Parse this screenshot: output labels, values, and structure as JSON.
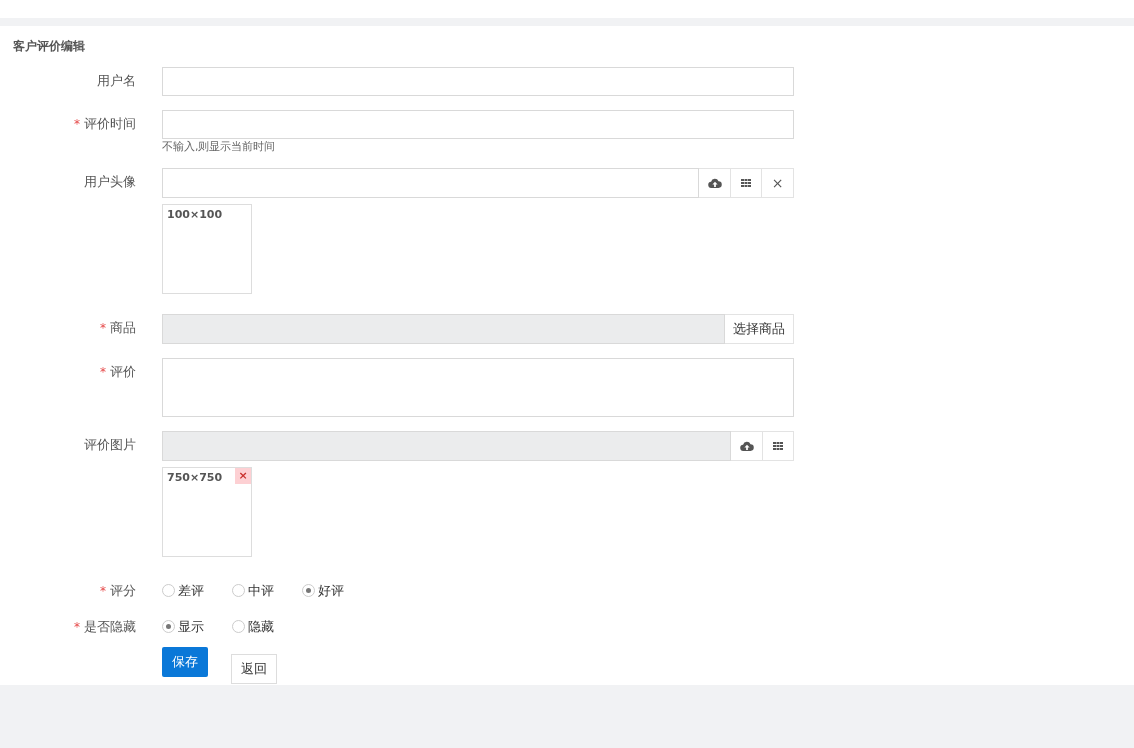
{
  "page_title": "客户评价编辑",
  "fields": [
    {
      "kind": "text",
      "label": "用户名"
    },
    {
      "kind": "text",
      "label": "评价时间",
      "required_mark": "*",
      "help": "不输入,则显示当前时间"
    },
    {
      "kind": "image",
      "label": "用户头像",
      "disabled": false,
      "clear": "×",
      "thumb": {
        "size": "100×100"
      }
    },
    {
      "kind": "picker",
      "label": "商品",
      "required_mark": "*",
      "disabled": true,
      "button": "选择商品"
    },
    {
      "kind": "textarea",
      "label": "评价",
      "required_mark": "*"
    },
    {
      "kind": "image",
      "label": "评价图片",
      "disabled": true,
      "thumb": {
        "size": "750×750",
        "remove": "×"
      }
    },
    {
      "kind": "radio",
      "label": "评分",
      "required_mark": "*",
      "options": [
        {
          "label": "差评",
          "selected": false
        },
        {
          "label": "中评",
          "selected": false
        },
        {
          "label": "好评",
          "selected": true
        }
      ]
    },
    {
      "kind": "radio",
      "label": "是否隐藏",
      "required_mark": "*",
      "options": [
        {
          "label": "显示",
          "selected": true
        },
        {
          "label": "隐藏",
          "selected": false
        }
      ]
    }
  ],
  "actions": [
    {
      "kind": "primary",
      "label": "保存"
    },
    {
      "kind": "default",
      "label": "返回"
    }
  ]
}
